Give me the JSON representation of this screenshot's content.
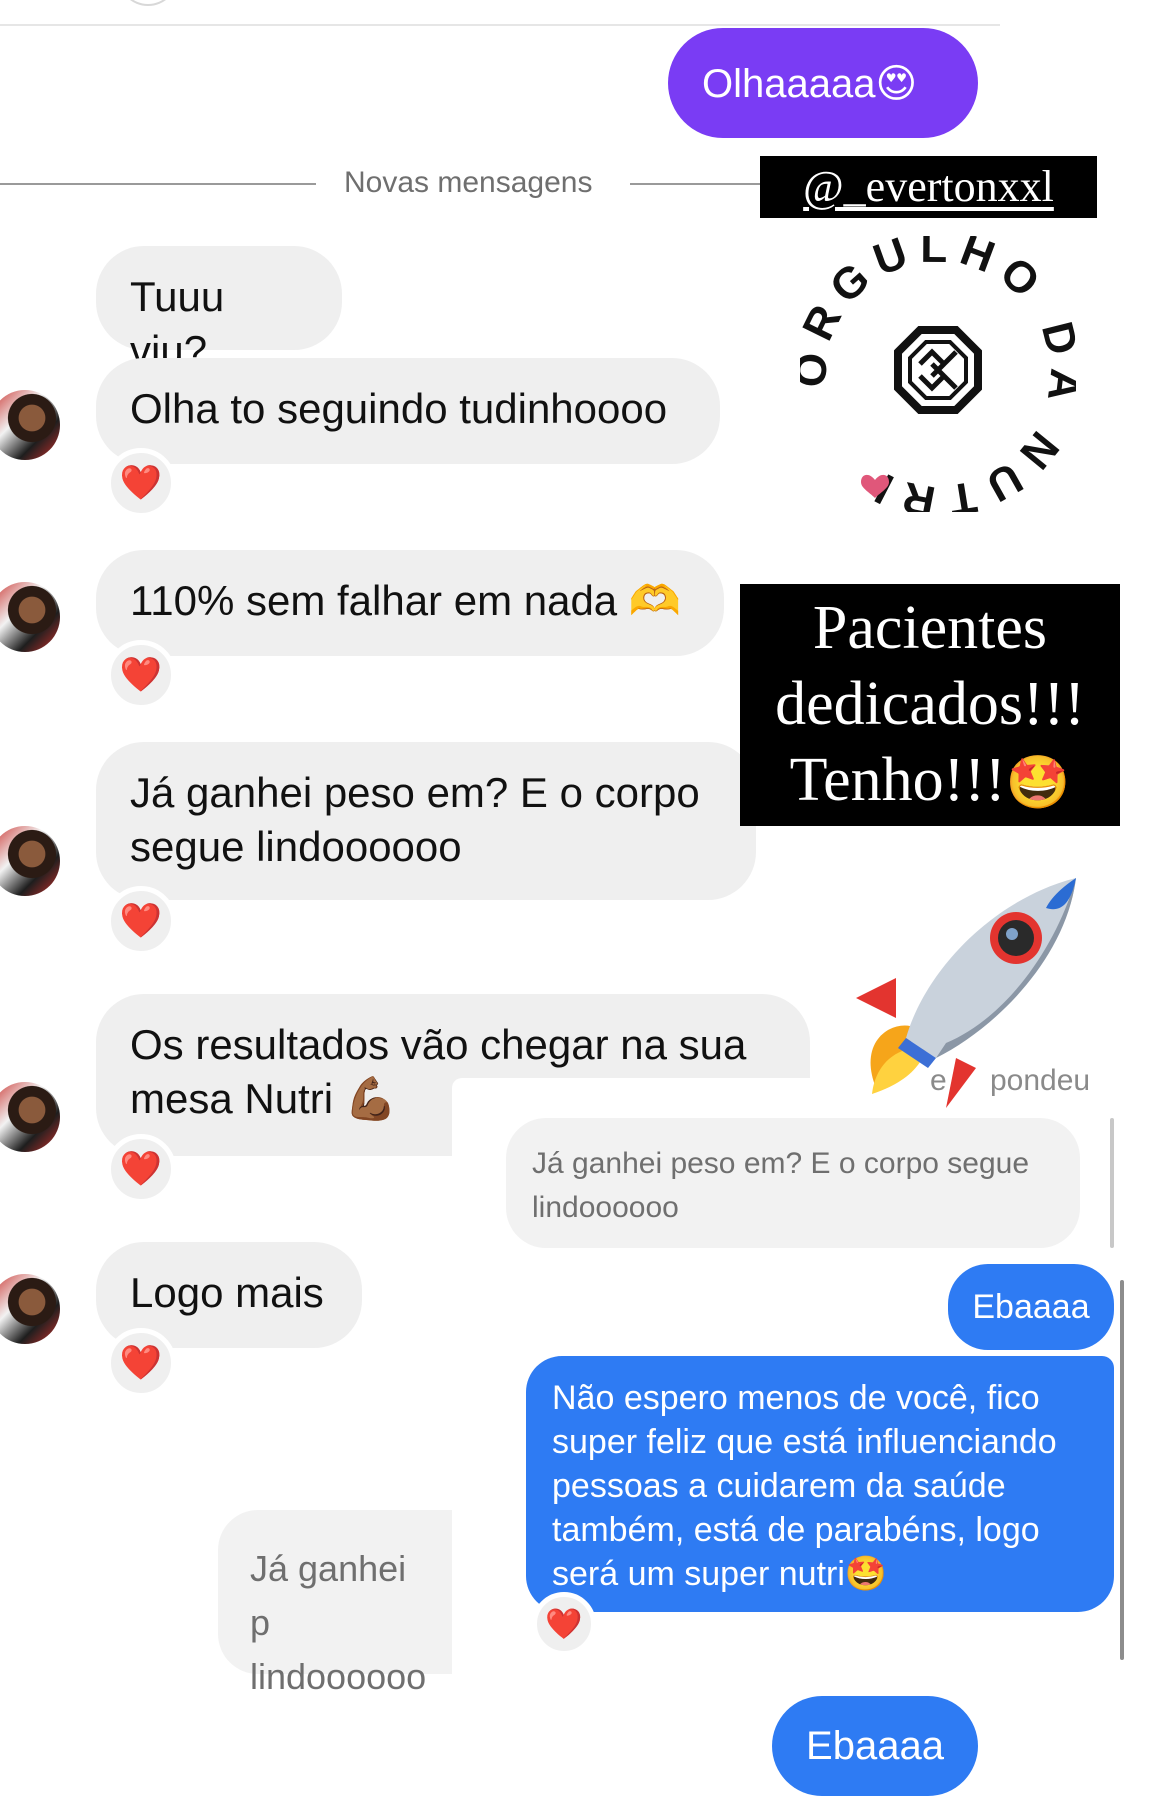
{
  "top": {
    "sent_message": "Olhaaaaa",
    "sent_emoji": "😍"
  },
  "divider": {
    "label": "Novas mensagens"
  },
  "stickers": {
    "handle": "@_evertonxxl",
    "circle_text": "ORGULHO DA NUTRI",
    "caption_line1": "Pacientes",
    "caption_line2": "dedicados!!!",
    "caption_line3": "Tenho!!!",
    "caption_emoji": "🤩",
    "rocket_icon": "rocket-icon"
  },
  "messages": [
    {
      "text": "Tuuu viu?",
      "reaction": "❤️"
    },
    {
      "text": "Olha to seguindo tudinhoooo",
      "reaction": "❤️"
    },
    {
      "text": "110% sem falhar em nada",
      "emoji": "🫶",
      "reaction": "❤️"
    },
    {
      "line1": "Já ganhei peso em? E o corpo",
      "line2": "segue lindoooooo",
      "reaction": "❤️"
    },
    {
      "line1": "Os resultados vão chegar na sua",
      "line2": "mesa Nutri",
      "emoji": "💪🏾",
      "reaction": "❤️"
    },
    {
      "text": "Logo mais",
      "reaction": "❤️"
    }
  ],
  "overlay": {
    "replied_label_fragment_a": "e",
    "replied_label_fragment_b": "pondeu",
    "quote_line1": "Já ganhei peso em? E o corpo segue",
    "quote_line2": "lindoooooo",
    "reply_short": "Ebaaaa",
    "reply_long_lines": [
      "Não espero menos de você, fico",
      "super feliz que está influenciando",
      "pessoas a cuidarem da saúde",
      "também, está de parabéns, logo",
      "será um super nutri"
    ],
    "reply_long_emoji": "🤩",
    "reply_reaction": "❤️"
  },
  "bottom_quote": {
    "line1": "Já ganhei p",
    "line2": "lindoooooo"
  },
  "bottom_sent": "Ebaaaa",
  "colors": {
    "purple": "#7a3cf4",
    "blue": "#2e7bf3",
    "incoming": "#efefef"
  }
}
